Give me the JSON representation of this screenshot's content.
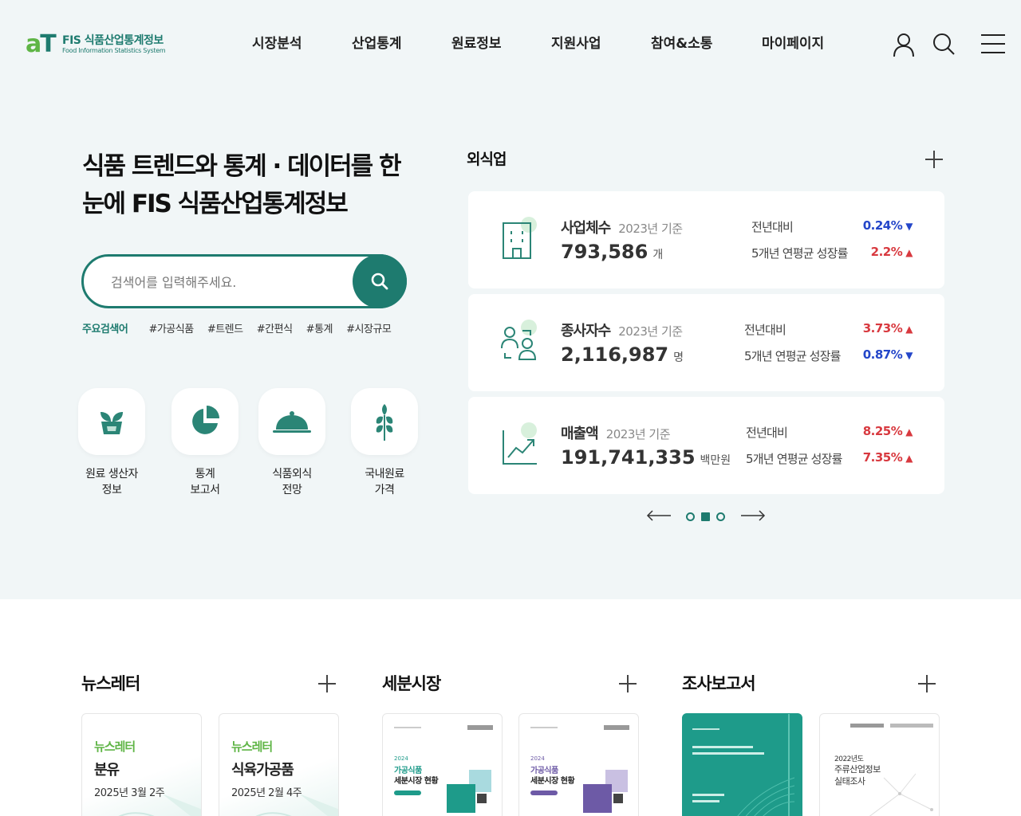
{
  "header": {
    "logo": {
      "mark": "aT",
      "title": "FIS 식품산업통계정보",
      "subtitle": "Food Information Statistics System"
    },
    "nav": [
      {
        "label": "시장분석"
      },
      {
        "label": "산업통계"
      },
      {
        "label": "원료정보"
      },
      {
        "label": "지원사업"
      },
      {
        "label": "참여&소통"
      },
      {
        "label": "마이페이지"
      }
    ],
    "icons": [
      "user-icon",
      "search-icon",
      "menu-icon"
    ]
  },
  "hero": {
    "headline_line1": "식품 트렌드와 통계 · 데이터를 한",
    "headline_line2": "눈에 FIS 식품산업통계정보",
    "search": {
      "placeholder": "검색어를 입력해주세요.",
      "value": ""
    },
    "keywords_label": "주요검색어",
    "keywords": [
      "#가공식품",
      "#트렌드",
      "#간편식",
      "#통계",
      "#시장규모"
    ],
    "quick_links": [
      {
        "line1": "원료 생산자",
        "line2": "정보",
        "icon": "sprout-icon"
      },
      {
        "line1": "통계",
        "line2": "보고서",
        "icon": "pie-chart-icon"
      },
      {
        "line1": "식품외식",
        "line2": "전망",
        "icon": "cloche-icon"
      },
      {
        "line1": "국내원료",
        "line2": "가격",
        "icon": "wheat-icon"
      }
    ]
  },
  "stats": {
    "title": "외식업",
    "items": [
      {
        "name": "사업체수",
        "base": "2023년 기준",
        "value": "793,586",
        "unit": "개",
        "icon": "building-icon",
        "cmp1_label": "전년대비",
        "cmp1_value": "0.24%",
        "cmp1_dir": "down",
        "cmp2_label": "5개년 연평균 성장률",
        "cmp2_value": "2.2%",
        "cmp2_dir": "up"
      },
      {
        "name": "종사자수",
        "base": "2023년 기준",
        "value": "2,116,987",
        "unit": "명",
        "icon": "people-icon",
        "cmp1_label": "전년대비",
        "cmp1_value": "3.73%",
        "cmp1_dir": "up",
        "cmp2_label": "5개년 연평균 성장률",
        "cmp2_value": "0.87%",
        "cmp2_dir": "down"
      },
      {
        "name": "매출액",
        "base": "2023년 기준",
        "value": "191,741,335",
        "unit": "백만원",
        "icon": "growth-chart-icon",
        "cmp1_label": "전년대비",
        "cmp1_value": "8.25%",
        "cmp1_dir": "up",
        "cmp2_label": "5개년 연평균 성장률",
        "cmp2_value": "7.35%",
        "cmp2_dir": "up"
      }
    ],
    "pager": {
      "pages": 3,
      "active": 2
    }
  },
  "sections": {
    "newsletter": {
      "title": "뉴스레터",
      "items": [
        {
          "kicker": "뉴스레터",
          "title": "분유",
          "date": "2025년 3월 2주"
        },
        {
          "kicker": "뉴스레터",
          "title": "식육가공품",
          "date": "2025년 2월 4주"
        }
      ]
    },
    "market": {
      "title": "세분시장",
      "items": [
        {
          "year": "2024",
          "line1": "가공식품",
          "line2": "세분시장 현황",
          "accent": "#1e9b8a"
        },
        {
          "year": "2024",
          "line1": "가공식품",
          "line2": "세분시장 현황",
          "accent": "#6d5aa6"
        }
      ]
    },
    "reports": {
      "title": "조사보고서",
      "items": [
        {
          "cover": "teal"
        },
        {
          "year": "2022년도",
          "line1": "주류산업정보",
          "line2": "실태조사"
        }
      ]
    }
  }
}
